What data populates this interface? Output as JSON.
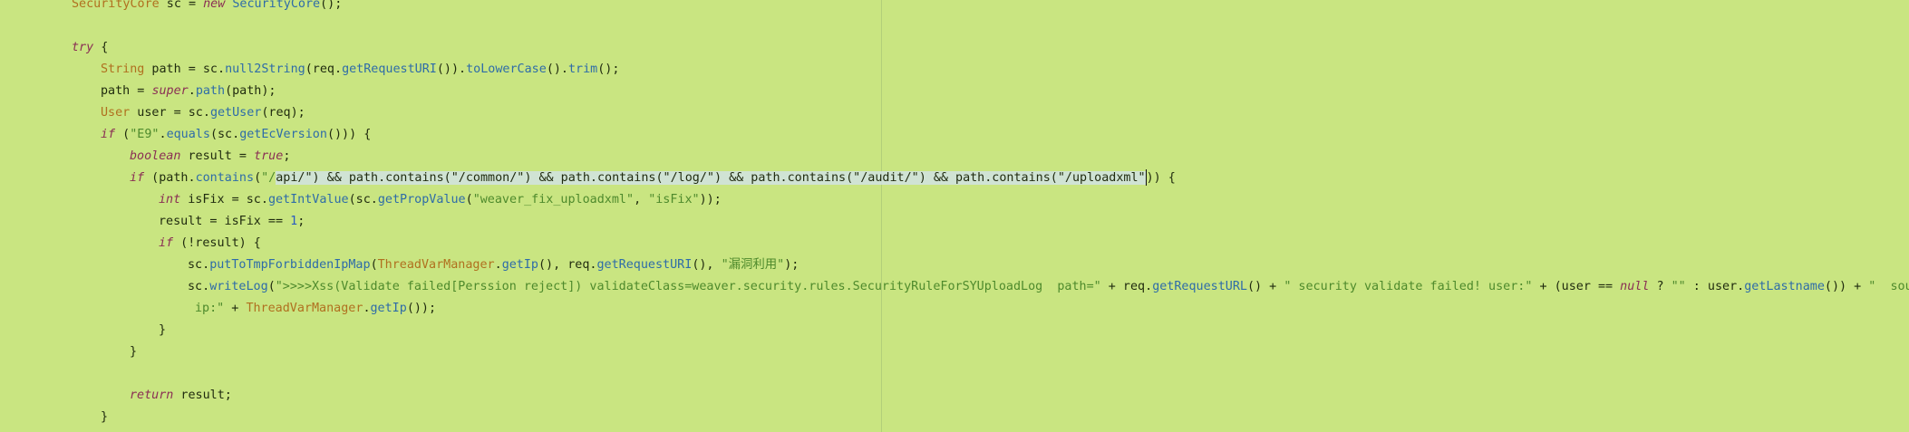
{
  "editor": {
    "colors": {
      "background": "#c9e581",
      "keyword": "#8a2f54",
      "type": "#b0701f",
      "method": "#2e6ca8",
      "string": "#4e8a2c",
      "number": "#2b5cc0",
      "plain": "#1f2a0e",
      "selection": "#d6e4f0"
    },
    "lines": [
      {
        "indent": 1,
        "tokens": [
          {
            "t": "SecurityCore",
            "c": "ty"
          },
          {
            "t": " sc = ",
            "c": "pl"
          },
          {
            "t": "new",
            "c": "kw"
          },
          {
            "t": " ",
            "c": "pl"
          },
          {
            "t": "SecurityCore",
            "c": "fn"
          },
          {
            "t": "();",
            "c": "pl"
          }
        ]
      },
      {
        "indent": 0,
        "tokens": []
      },
      {
        "indent": 1,
        "tokens": [
          {
            "t": "try",
            "c": "kw"
          },
          {
            "t": " {",
            "c": "pl"
          }
        ]
      },
      {
        "indent": 2,
        "tokens": [
          {
            "t": "String",
            "c": "ty"
          },
          {
            "t": " path = sc.",
            "c": "pl"
          },
          {
            "t": "null2String",
            "c": "fn"
          },
          {
            "t": "(req.",
            "c": "pl"
          },
          {
            "t": "getRequestURI",
            "c": "fn"
          },
          {
            "t": "()).",
            "c": "pl"
          },
          {
            "t": "toLowerCase",
            "c": "fn"
          },
          {
            "t": "().",
            "c": "pl"
          },
          {
            "t": "trim",
            "c": "fn"
          },
          {
            "t": "();",
            "c": "pl"
          }
        ]
      },
      {
        "indent": 2,
        "tokens": [
          {
            "t": "path = ",
            "c": "pl"
          },
          {
            "t": "super",
            "c": "kw"
          },
          {
            "t": ".",
            "c": "pl"
          },
          {
            "t": "path",
            "c": "fn"
          },
          {
            "t": "(path);",
            "c": "pl"
          }
        ]
      },
      {
        "indent": 2,
        "tokens": [
          {
            "t": "User",
            "c": "ty"
          },
          {
            "t": " user = sc.",
            "c": "pl"
          },
          {
            "t": "getUser",
            "c": "fn"
          },
          {
            "t": "(req);",
            "c": "pl"
          }
        ]
      },
      {
        "indent": 2,
        "tokens": [
          {
            "t": "if",
            "c": "kw"
          },
          {
            "t": " (",
            "c": "pl"
          },
          {
            "t": "\"E9\"",
            "c": "st"
          },
          {
            "t": ".",
            "c": "pl"
          },
          {
            "t": "equals",
            "c": "fn"
          },
          {
            "t": "(sc.",
            "c": "pl"
          },
          {
            "t": "getEcVersion",
            "c": "fn"
          },
          {
            "t": "())) {",
            "c": "pl"
          }
        ]
      },
      {
        "indent": 3,
        "tokens": [
          {
            "t": "boolean",
            "c": "kw"
          },
          {
            "t": " result = ",
            "c": "pl"
          },
          {
            "t": "true",
            "c": "kw"
          },
          {
            "t": ";",
            "c": "pl"
          }
        ]
      },
      {
        "indent": 3,
        "tokens": [
          {
            "t": "if",
            "c": "kw"
          },
          {
            "t": " (path.",
            "c": "pl"
          },
          {
            "t": "contains",
            "c": "fn"
          },
          {
            "t": "(",
            "c": "pl"
          },
          {
            "t": "\"/",
            "c": "st"
          },
          {
            "t": "api/\") && path.contains(\"/common/\") && path.contains(\"/log/\") && path.contains(\"/audit/\") && path.contains(\"/uploadxml\"",
            "c": "pl",
            "sel": true
          },
          {
            "t": "",
            "c": "caret"
          },
          {
            "t": ")) {",
            "c": "pl"
          }
        ]
      },
      {
        "indent": 4,
        "tokens": [
          {
            "t": "int",
            "c": "kw"
          },
          {
            "t": " isFix = sc.",
            "c": "pl"
          },
          {
            "t": "getIntValue",
            "c": "fn"
          },
          {
            "t": "(sc.",
            "c": "pl"
          },
          {
            "t": "getPropValue",
            "c": "fn"
          },
          {
            "t": "(",
            "c": "pl"
          },
          {
            "t": "\"weaver_fix_uploadxml\"",
            "c": "st"
          },
          {
            "t": ", ",
            "c": "pl"
          },
          {
            "t": "\"isFix\"",
            "c": "st"
          },
          {
            "t": "));",
            "c": "pl"
          }
        ]
      },
      {
        "indent": 4,
        "tokens": [
          {
            "t": "result = isFix == ",
            "c": "pl"
          },
          {
            "t": "1",
            "c": "nu"
          },
          {
            "t": ";",
            "c": "pl"
          }
        ]
      },
      {
        "indent": 4,
        "tokens": [
          {
            "t": "if",
            "c": "kw"
          },
          {
            "t": " (!result) {",
            "c": "pl"
          }
        ]
      },
      {
        "indent": 5,
        "tokens": [
          {
            "t": "sc.",
            "c": "pl"
          },
          {
            "t": "putToTmpForbiddenIpMap",
            "c": "fn"
          },
          {
            "t": "(",
            "c": "pl"
          },
          {
            "t": "ThreadVarManager",
            "c": "ty"
          },
          {
            "t": ".",
            "c": "pl"
          },
          {
            "t": "getIp",
            "c": "fn"
          },
          {
            "t": "(), req.",
            "c": "pl"
          },
          {
            "t": "getRequestURI",
            "c": "fn"
          },
          {
            "t": "(), ",
            "c": "pl"
          },
          {
            "t": "\"漏洞利用\"",
            "c": "st"
          },
          {
            "t": ");",
            "c": "pl"
          }
        ]
      },
      {
        "indent": 5,
        "tokens": [
          {
            "t": "sc.",
            "c": "pl"
          },
          {
            "t": "writeLog",
            "c": "fn"
          },
          {
            "t": "(",
            "c": "pl"
          },
          {
            "t": "\">>>>Xss(Validate failed[Perssion reject]) validateClass=weaver.security.rules.SecurityRuleForSYUploadLog  path=\"",
            "c": "st"
          },
          {
            "t": " + req.",
            "c": "pl"
          },
          {
            "t": "getRequestURL",
            "c": "fn"
          },
          {
            "t": "() + ",
            "c": "pl"
          },
          {
            "t": "\" security validate failed! user:\"",
            "c": "st"
          },
          {
            "t": " + (user == ",
            "c": "pl"
          },
          {
            "t": "null",
            "c": "kw"
          },
          {
            "t": " ? ",
            "c": "pl"
          },
          {
            "t": "\"\"",
            "c": "st"
          },
          {
            "t": " : user.",
            "c": "pl"
          },
          {
            "t": "getLastname",
            "c": "fn"
          },
          {
            "t": "()) + ",
            "c": "pl"
          },
          {
            "t": "\"  source",
            "c": "st"
          }
        ]
      },
      {
        "indent": 5,
        "extra": 1,
        "tokens": [
          {
            "t": "ip:\"",
            "c": "st"
          },
          {
            "t": " + ",
            "c": "pl"
          },
          {
            "t": "ThreadVarManager",
            "c": "ty"
          },
          {
            "t": ".",
            "c": "pl"
          },
          {
            "t": "getIp",
            "c": "fn"
          },
          {
            "t": "());",
            "c": "pl"
          }
        ]
      },
      {
        "indent": 4,
        "tokens": [
          {
            "t": "}",
            "c": "pl"
          }
        ]
      },
      {
        "indent": 3,
        "tokens": [
          {
            "t": "}",
            "c": "pl"
          }
        ]
      },
      {
        "indent": 0,
        "tokens": []
      },
      {
        "indent": 3,
        "tokens": [
          {
            "t": "return",
            "c": "kw"
          },
          {
            "t": " result;",
            "c": "pl"
          }
        ]
      },
      {
        "indent": 2,
        "tokens": [
          {
            "t": "}",
            "c": "pl"
          }
        ]
      }
    ]
  }
}
